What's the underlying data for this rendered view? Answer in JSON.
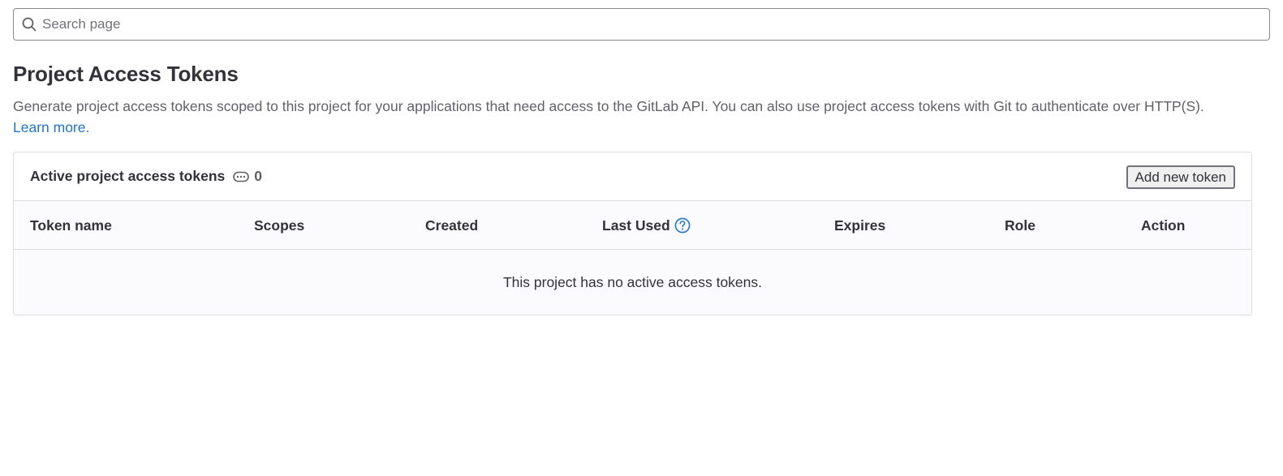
{
  "search": {
    "placeholder": "Search page",
    "icon": "search-icon"
  },
  "header": {
    "title": "Project Access Tokens",
    "description": "Generate project access tokens scoped to this project for your applications that need access to the GitLab API. You can also use project access tokens with Git to authenticate over HTTP(S).",
    "learn_more": "Learn more."
  },
  "tokens_card": {
    "title": "Active project access tokens",
    "count_icon": "token-icon",
    "count": "0",
    "add_button": "Add new token",
    "columns": [
      "Token name",
      "Scopes",
      "Created",
      "Last Used",
      "Expires",
      "Role",
      "Action"
    ],
    "help_icon": "question-circle-icon",
    "empty_message": "This project has no active access tokens."
  },
  "colors": {
    "link": "#1f75cb",
    "border": "#dcdcde",
    "table_bg": "#fbfafd"
  }
}
